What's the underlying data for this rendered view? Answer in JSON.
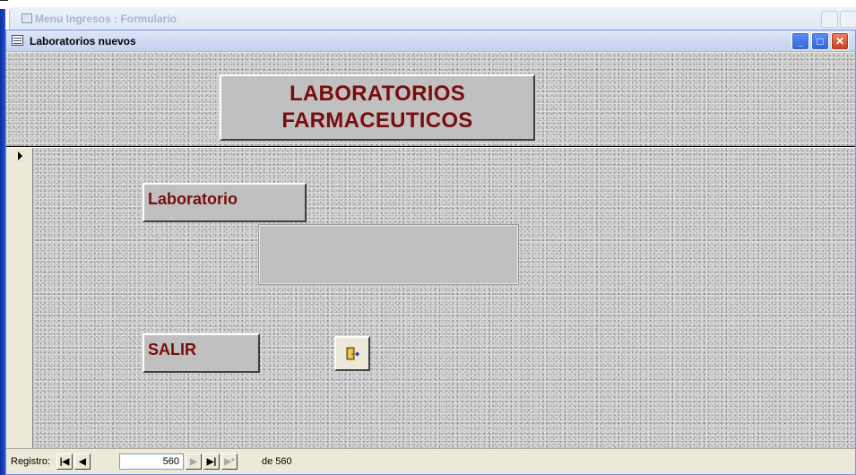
{
  "background_window": {
    "title": "Menu Ingresos : Formulario"
  },
  "window": {
    "title": "Laboratorios nuevos",
    "minimize": "_",
    "maximize": "□",
    "close": "✕"
  },
  "form": {
    "header_line1": "LABORATORIOS",
    "header_line2": "FARMACEUTICOS",
    "laboratorio_label": "Laboratorio",
    "laboratorio_value": "",
    "salir_label": "SALIR",
    "exit_icon": "door-exit-icon"
  },
  "navigation": {
    "label": "Registro:",
    "first": "|◀",
    "prev": "◀",
    "current": "560",
    "next": "▶",
    "last": "▶|",
    "new": "▶*",
    "of_text": "de 560"
  },
  "colors": {
    "label_text": "#7a0c0c",
    "form_background": "#c7c7c7"
  }
}
